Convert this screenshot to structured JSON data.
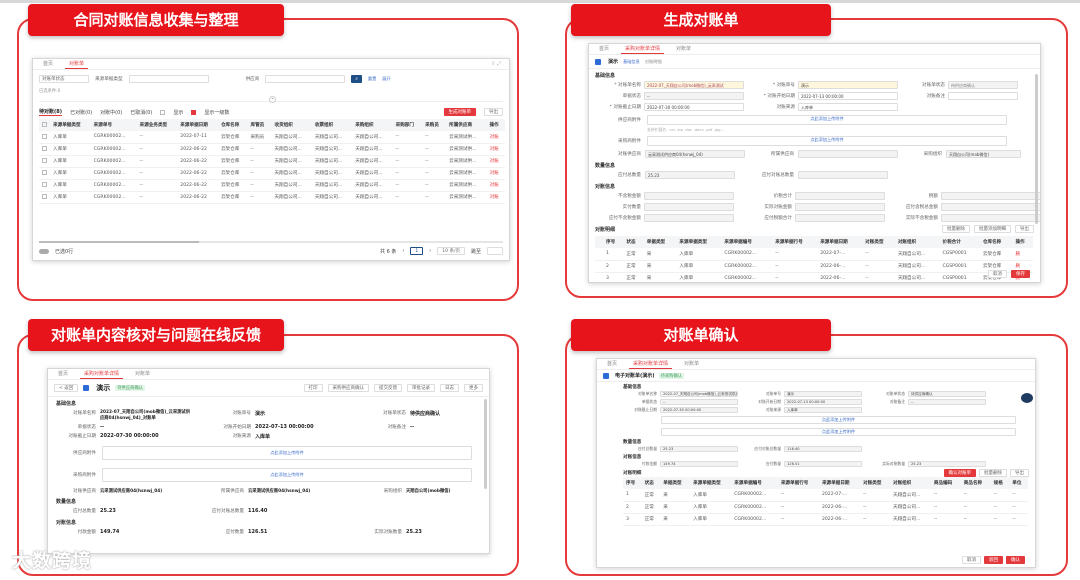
{
  "panels": {
    "p1": {
      "title": "合同对账信息收集与整理"
    },
    "p2": {
      "title": "生成对账单"
    },
    "p3": {
      "title": "对账单内容核对与问题在线反馈"
    },
    "p4": {
      "title": "对账单确认"
    }
  },
  "shot1": {
    "tabs": [
      "首页",
      "对账单"
    ],
    "filter": {
      "select1": "对账单状态",
      "label2": "来源单据类型",
      "label3": "供应商",
      "search_btn": "搜索",
      "reset": "重置",
      "more": "展开",
      "count_text": "已选条件:0"
    },
    "subtabs": [
      "待对账(8)",
      "已对账(0)",
      "对账中(0)",
      "已取消(0)"
    ],
    "checks": [
      "显示",
      "显示一级数"
    ],
    "action_btn": "生成对账单",
    "action_btn2": "导出",
    "columns": [
      "来源单据类型",
      "来源单号",
      "来源业务类型",
      "来源单据日期",
      "仓库名称",
      "库管员",
      "收货组织",
      "收票组织",
      "采购组织",
      "采购部门",
      "采购员",
      "所属供应商",
      "操作"
    ],
    "rows": [
      [
        "入库单",
        "CGRK00002...",
        "--",
        "2022-07-11",
        "云架仓库",
        "采购员",
        "天翔自公司...",
        "天翔自公司...",
        "天翔自公司...",
        "--",
        "--",
        "云采测试供...",
        "对账"
      ],
      [
        "入库单",
        "CGRK00002...",
        "--",
        "2022-06-22",
        "云架仓库",
        "--",
        "天翔自公司...",
        "天翔自公司...",
        "天翔自公司...",
        "--",
        "--",
        "云采测试供...",
        "对账"
      ],
      [
        "入库单",
        "CGRK00002...",
        "--",
        "2022-06-22",
        "云架仓库",
        "--",
        "天翔自公司...",
        "天翔自公司...",
        "天翔自公司...",
        "--",
        "--",
        "云采测试供...",
        "对账"
      ],
      [
        "入库单",
        "CGRK00002...",
        "--",
        "2022-06-22",
        "云架仓库",
        "--",
        "天翔自公司...",
        "天翔自公司...",
        "天翔自公司...",
        "--",
        "--",
        "云采测试供...",
        "对账"
      ],
      [
        "入库单",
        "CGRK00002...",
        "--",
        "2022-06-22",
        "云架仓库",
        "--",
        "天翔自公司...",
        "天翔自公司...",
        "天翔自公司...",
        "--",
        "--",
        "云采测试供...",
        "对账"
      ],
      [
        "入库单",
        "CGRK00002...",
        "--",
        "2022-06-22",
        "云架仓库",
        "--",
        "天翔自公司...",
        "天翔自公司...",
        "天翔自公司...",
        "--",
        "--",
        "云采测试供...",
        "对账"
      ]
    ],
    "footer_left": "已选0行",
    "pager": {
      "total": "共 6 条",
      "page": "1",
      "size": "10 条/页",
      "goto": "跳至"
    }
  },
  "shot2": {
    "tabs": [
      "首页",
      "采购对账单详情",
      "对账单"
    ],
    "title": "演示",
    "title_tabs": [
      "基础信息",
      "对账明细"
    ],
    "section1": "基础信息",
    "fields": [
      {
        "label": "* 对账单名称",
        "value": "2022-07_天翔自公司(mob微信)_云采测试"
      },
      {
        "label": "* 对账单号",
        "value": "演示"
      },
      {
        "label": "对账单状态",
        "value": "待供应商确认"
      },
      {
        "label": "单据状态",
        "value": "--"
      },
      {
        "label": "* 对账开始日期",
        "value": "2022-07-13 00:00:00"
      },
      {
        "label": "对账备注",
        "value": ""
      },
      {
        "label": "* 对账截止日期",
        "value": "2022-07-30 00:00:00"
      },
      {
        "label": "对账来源",
        "value": "入库单"
      }
    ],
    "attach_label": "供应商附件",
    "upload_link": "点此添加上传附件",
    "upload_hint": "支持扩展名: .rar .zip .doc .docx .pdf .jpg...",
    "attach2_label": "采购商附件",
    "supplier_label": "对账供应商",
    "supplier_value": "云采测试供应商04(hsnwj_04)",
    "org_label": "所属供应商",
    "buyer_label": "采购组织",
    "buyer_value": "天翔自公司(mob微信)",
    "section2": "数量信息",
    "qty_label": "应付总数量",
    "qty_value": "25.23",
    "qty2_label": "应付对账总数量",
    "section3": "对账信息",
    "amount_labels": [
      "不含税金额",
      "价税合计",
      "税额",
      "实付数量",
      "实际对账金额",
      "应付含税总金额",
      "应付不含税金额",
      "应付税额合计",
      "实际不含税金额"
    ],
    "section4": "对账明细",
    "detail_btns": [
      "批量删除",
      "批量添加明细",
      "导出"
    ],
    "detail_cols": [
      "",
      "序号",
      "状态",
      "单据类型",
      "来源单据类型",
      "来源单据编号",
      "来源单据行号",
      "来源单据日期",
      "对账类型",
      "对账组织",
      "价税合计",
      "仓库名称",
      "操作"
    ],
    "detail_rows": [
      [
        "",
        "1",
        "正常",
        "采",
        "入库单",
        "CGRK00002...",
        "--",
        "2022-07-...",
        "--",
        "天翔自公司...",
        "CGSP0001",
        "云架仓库",
        "删"
      ],
      [
        "",
        "2",
        "正常",
        "采",
        "入库单",
        "CGRK00002...",
        "--",
        "2022-06-...",
        "--",
        "天翔自公司...",
        "CGSP0001",
        "云架仓库",
        "删"
      ],
      [
        "",
        "3",
        "正常",
        "采",
        "入库单",
        "CGRK00002...",
        "--",
        "2022-06-...",
        "--",
        "天翔自公司...",
        "CGSP0001",
        "云架仓库",
        "删"
      ]
    ],
    "bottom_btns": [
      "取消",
      "保存"
    ]
  },
  "shot3": {
    "tabs": [
      "首页",
      "采购对账单详情",
      "对账单"
    ],
    "back": "< 返回",
    "title": "演示",
    "badge": "待供应商确认",
    "action_btns": [
      "打印",
      "采购供应商确认",
      "提交反馈",
      "审批记录",
      "日志",
      "更多"
    ],
    "section1": "基础信息",
    "fields": [
      {
        "label": "对账单名称",
        "value": "2022-07_天翔自公司(mob微信)_云采测试供应商04(hsnwj_04)_对账单"
      },
      {
        "label": "对账单号",
        "value": "演示"
      },
      {
        "label": "对账单状态",
        "value": "待供应商确认"
      },
      {
        "label": "单据状态",
        "value": "--"
      },
      {
        "label": "对账开始日期",
        "value": "2022-07-13 00:00:00"
      },
      {
        "label": "对账备注",
        "value": "--"
      },
      {
        "label": "对账截止日期",
        "value": "2022-07-30 00:00:00"
      },
      {
        "label": "对账来源",
        "value": "入库单"
      }
    ],
    "attach_label": "供应商附件",
    "upload_link": "点此添加上传附件",
    "attach2_label": "采购商附件",
    "supplier_label": "对账供应商",
    "supplier_value": "云采测试供应商04(hsnwj_04)",
    "org_label": "所属供应商",
    "org_value": "云采测试供应商04(hsnwj_04)",
    "buyer_label": "采购组织",
    "buyer_value": "天翔自公司(mob微信)",
    "section2": "数量信息",
    "qty_label": "应付总数量",
    "qty_value": "25.23",
    "qty2_label": "应付对账总数量",
    "qty2_value": "116.40",
    "section3": "对账信息",
    "amt1_label": "付款金额",
    "amt1_value": "149.74",
    "amt2_label": "应付数量",
    "amt2_value": "126.51",
    "amt3_label": "实际对账数量",
    "amt3_value": "25.23"
  },
  "shot4": {
    "tabs": [
      "首页",
      "采购对账单详情",
      "对账单"
    ],
    "title": "电子对账单(演示)",
    "badge": "待采购确认",
    "section1": "基础信息",
    "section2": "数量信息",
    "section3": "对账信息",
    "section4": "对账明细",
    "upload_link": "点此添加上传附件",
    "confirm_btn": "确认对账单",
    "detail_btns": [
      "批量删除",
      "导出"
    ],
    "detail_cols": [
      "序号",
      "状态",
      "单据类型",
      "来源单据类型",
      "来源单据编号",
      "来源单据行号",
      "来源单据日期",
      "对账类型",
      "对账组织",
      "商品编码",
      "商品名称",
      "规格",
      "单位"
    ],
    "detail_rows": [
      [
        "1",
        "正常",
        "采",
        "入库单",
        "CGRK00002...",
        "--",
        "2022-07-...",
        "--",
        "天翔自公司...",
        "--",
        "--",
        "--",
        "--"
      ],
      [
        "2",
        "正常",
        "采",
        "入库单",
        "CGRK00002...",
        "--",
        "2022-06-...",
        "--",
        "天翔自公司...",
        "--",
        "--",
        "--",
        "--"
      ],
      [
        "3",
        "正常",
        "采",
        "入库单",
        "CGRK00002...",
        "--",
        "2022-06-...",
        "--",
        "天翔自公司...",
        "--",
        "--",
        "--",
        "--"
      ]
    ],
    "bottom_btns": [
      "取消",
      "驳回",
      "确认"
    ]
  },
  "watermark": "大数跨境",
  "colors": {
    "accent": "#e8141c",
    "border": "#e63a3a",
    "link": "#3b6cc9"
  }
}
